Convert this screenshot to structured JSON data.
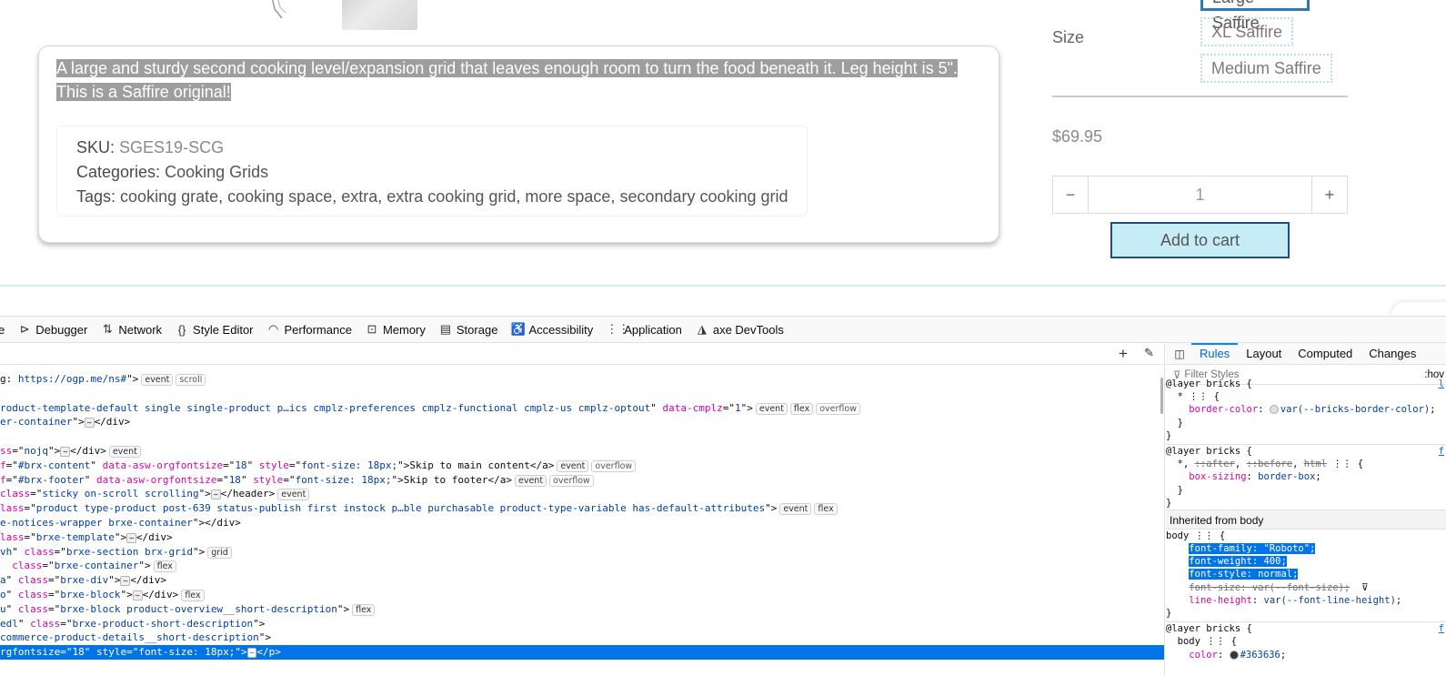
{
  "product": {
    "description": "A large and sturdy second cooking level/expansion grid that leaves enough room to turn the food beneath it. Leg height is 5\". This is a Saffire original!",
    "sku_label": "SKU:",
    "sku_value": "SGES19-SCG",
    "categories_label": "Categories:",
    "categories_value": "Cooking Grids",
    "tags_label": "Tags:",
    "tags": [
      "cooking grate",
      "cooking space",
      "extra",
      "extra cooking grid",
      "more space",
      "secondary cooking grid"
    ],
    "size_label": "Size",
    "size_options": [
      "Large Saffire",
      "XL Saffire",
      "Medium Saffire"
    ],
    "price": "$69.95",
    "quantity": "1",
    "minus_label": "−",
    "plus_label": "+",
    "add_to_cart": "Add to cart",
    "colors": {
      "cart_bg": "#c6ecf6",
      "cart_border": "#1c4f7a",
      "chip_selected": "#2b7bb9"
    }
  },
  "devtools": {
    "tools": [
      {
        "icon": "console-icon",
        "glyph": "",
        "label": "e"
      },
      {
        "icon": "debugger-icon",
        "glyph": "⊳",
        "label": "Debugger"
      },
      {
        "icon": "network-icon",
        "glyph": "⇅",
        "label": "Network"
      },
      {
        "icon": "style-editor-icon",
        "glyph": "{}",
        "label": "Style Editor"
      },
      {
        "icon": "performance-icon",
        "glyph": "◠",
        "label": "Performance"
      },
      {
        "icon": "memory-icon",
        "glyph": "⊡",
        "label": "Memory"
      },
      {
        "icon": "storage-icon",
        "glyph": "▤",
        "label": "Storage"
      },
      {
        "icon": "accessibility-icon",
        "glyph": "♿",
        "label": "Accessibility"
      },
      {
        "icon": "application-icon",
        "glyph": "⋮⋮",
        "label": "Application"
      },
      {
        "icon": "axe-icon",
        "glyph": "◮",
        "label": "axe DevTools"
      }
    ],
    "markup_lines": [
      {
        "parts": [
          [
            "t",
            "g: "
          ],
          [
            "v",
            "https://ogp.me/ns#"
          ],
          [
            "t",
            "\">"
          ]
        ],
        "badges": [
          "event",
          "scroll"
        ]
      },
      {
        "parts": [],
        "badges": []
      },
      {
        "parts": [
          [
            "v",
            "roduct-template-default single single-product p…ics cmplz-preferences cmplz-functional cmplz-us cmplz-optout"
          ],
          [
            "t",
            "\" "
          ],
          [
            "a",
            "data-cmplz"
          ],
          [
            "t",
            "=\""
          ],
          [
            "v",
            "1"
          ],
          [
            "t",
            "\">"
          ]
        ],
        "badges": [
          "event",
          "flex",
          "overflow"
        ]
      },
      {
        "parts": [
          [
            "v",
            "er-container"
          ],
          [
            "t",
            "\">"
          ],
          [
            "d",
            "⋯"
          ],
          [
            "t",
            "</div>"
          ]
        ],
        "badges": []
      },
      {
        "parts": [],
        "badges": []
      },
      {
        "parts": [
          [
            "a",
            "ss"
          ],
          [
            "t",
            "=\""
          ],
          [
            "v",
            "nojq"
          ],
          [
            "t",
            "\">"
          ],
          [
            "d",
            "⋯"
          ],
          [
            "t",
            "</div>"
          ]
        ],
        "badges": [
          "event"
        ]
      },
      {
        "parts": [
          [
            "a",
            "f"
          ],
          [
            "t",
            "=\""
          ],
          [
            "v",
            "#brx-content"
          ],
          [
            "t",
            "\" "
          ],
          [
            "a",
            "data-asw-orgfontsize"
          ],
          [
            "t",
            "=\""
          ],
          [
            "v",
            "18"
          ],
          [
            "t",
            "\" "
          ],
          [
            "a",
            "style"
          ],
          [
            "t",
            "=\""
          ],
          [
            "v",
            "font-size: 18px;"
          ],
          [
            "t",
            "\">Skip to main content</a>"
          ]
        ],
        "badges": [
          "event",
          "overflow"
        ]
      },
      {
        "parts": [
          [
            "a",
            "f"
          ],
          [
            "t",
            "=\""
          ],
          [
            "v",
            "#brx-footer"
          ],
          [
            "t",
            "\" "
          ],
          [
            "a",
            "data-asw-orgfontsize"
          ],
          [
            "t",
            "=\""
          ],
          [
            "v",
            "18"
          ],
          [
            "t",
            "\" "
          ],
          [
            "a",
            "style"
          ],
          [
            "t",
            "=\""
          ],
          [
            "v",
            "font-size: 18px;"
          ],
          [
            "t",
            "\">Skip to footer</a>"
          ]
        ],
        "badges": [
          "event",
          "overflow"
        ]
      },
      {
        "parts": [
          [
            "a",
            "class"
          ],
          [
            "t",
            "=\""
          ],
          [
            "v",
            "sticky on-scroll scrolling"
          ],
          [
            "t",
            "\">"
          ],
          [
            "d",
            "⋯"
          ],
          [
            "t",
            "</header>"
          ]
        ],
        "badges": [
          "event"
        ]
      },
      {
        "parts": [
          [
            "a",
            "lass"
          ],
          [
            "t",
            "=\""
          ],
          [
            "v",
            "product type-product post-639 status-publish first instock p…ble purchasable product-type-variable has-default-attributes"
          ],
          [
            "t",
            "\">"
          ]
        ],
        "badges": [
          "event",
          "flex"
        ]
      },
      {
        "parts": [
          [
            "v",
            "e-notices-wrapper brxe-container"
          ],
          [
            "t",
            "\"></div>"
          ]
        ],
        "badges": []
      },
      {
        "parts": [
          [
            "a",
            "lass"
          ],
          [
            "t",
            "=\""
          ],
          [
            "v",
            "brxe-template"
          ],
          [
            "t",
            "\">"
          ],
          [
            "d",
            "⋯"
          ],
          [
            "t",
            "</div>"
          ]
        ],
        "badges": []
      },
      {
        "parts": [
          [
            "v",
            "vh"
          ],
          [
            "t",
            "\" "
          ],
          [
            "a",
            "class"
          ],
          [
            "t",
            "=\""
          ],
          [
            "v",
            "brxe-section brx-grid"
          ],
          [
            "t",
            "\">"
          ]
        ],
        "badges": [
          "grid"
        ]
      },
      {
        "parts": [
          [
            "t",
            "  "
          ],
          [
            "a",
            "class"
          ],
          [
            "t",
            "=\""
          ],
          [
            "v",
            "brxe-container"
          ],
          [
            "t",
            "\">"
          ]
        ],
        "badges": [
          "flex"
        ]
      },
      {
        "parts": [
          [
            "v",
            "a"
          ],
          [
            "t",
            "\" "
          ],
          [
            "a",
            "class"
          ],
          [
            "t",
            "=\""
          ],
          [
            "v",
            "brxe-div"
          ],
          [
            "t",
            "\">"
          ],
          [
            "d",
            "⋯"
          ],
          [
            "t",
            "</div>"
          ]
        ],
        "badges": []
      },
      {
        "parts": [
          [
            "v",
            "o"
          ],
          [
            "t",
            "\" "
          ],
          [
            "a",
            "class"
          ],
          [
            "t",
            "=\""
          ],
          [
            "v",
            "brxe-block"
          ],
          [
            "t",
            "\">"
          ],
          [
            "d",
            "⋯"
          ],
          [
            "t",
            "</div>"
          ]
        ],
        "badges": [
          "flex"
        ]
      },
      {
        "parts": [
          [
            "v",
            "u"
          ],
          [
            "t",
            "\" "
          ],
          [
            "a",
            "class"
          ],
          [
            "t",
            "=\""
          ],
          [
            "v",
            "brxe-block product-overview__short-description"
          ],
          [
            "t",
            "\">"
          ]
        ],
        "badges": [
          "flex"
        ]
      },
      {
        "parts": [
          [
            "v",
            "edl"
          ],
          [
            "t",
            "\" "
          ],
          [
            "a",
            "class"
          ],
          [
            "t",
            "=\""
          ],
          [
            "v",
            "brxe-product-short-description"
          ],
          [
            "t",
            "\">"
          ]
        ],
        "badges": []
      },
      {
        "parts": [
          [
            "v",
            "commerce-product-details__short-description"
          ],
          [
            "t",
            "\">"
          ]
        ],
        "badges": []
      },
      {
        "parts": [
          [
            "v",
            "rgfontsize"
          ],
          [
            "t",
            "=\""
          ],
          [
            "v",
            "18"
          ],
          [
            "t",
            "\" "
          ],
          [
            "a",
            "style"
          ],
          [
            "t",
            "=\""
          ],
          [
            "v",
            "font-size: 18px;"
          ],
          [
            "t",
            "\">"
          ],
          [
            "d",
            "⋯"
          ],
          [
            "t",
            "</p>"
          ]
        ],
        "badges": [],
        "selected": true
      }
    ],
    "right_tabs": [
      "Rules",
      "Layout",
      "Computed",
      "Changes"
    ],
    "active_tab": "Rules",
    "filter_placeholder": "Filter Styles",
    "hov_label": ":hov",
    "inherited_label": "Inherited from body",
    "rules": [
      {
        "kind": "line",
        "html": [
          [
            "t",
            "@layer bricks {"
          ]
        ],
        "src": "l"
      },
      {
        "kind": "line",
        "html": [
          [
            "t",
            "  * "
          ],
          [
            "t",
            "⋮⋮ {"
          ]
        ]
      },
      {
        "kind": "line",
        "html": [
          [
            "t",
            "    "
          ],
          [
            "p",
            "border-color"
          ],
          [
            "t",
            ": "
          ],
          [
            "sw",
            "#e0e0e0"
          ],
          [
            "pv",
            "var(--bricks-border-color)"
          ],
          [
            "t",
            ";"
          ]
        ]
      },
      {
        "kind": "line",
        "html": [
          [
            "t",
            "  }"
          ]
        ]
      },
      {
        "kind": "line",
        "html": [
          [
            "t",
            "}"
          ]
        ]
      },
      {
        "kind": "sep"
      },
      {
        "kind": "line",
        "html": [
          [
            "t",
            "@layer bricks {"
          ]
        ],
        "src": "f"
      },
      {
        "kind": "line",
        "html": [
          [
            "t",
            "  *, "
          ],
          [
            "s",
            "::after"
          ],
          [
            "t",
            ", "
          ],
          [
            "s",
            "::before"
          ],
          [
            "t",
            ", "
          ],
          [
            "s",
            "html"
          ],
          [
            "t",
            " ⋮⋮ {"
          ]
        ]
      },
      {
        "kind": "line",
        "html": [
          [
            "t",
            "    "
          ],
          [
            "p",
            "box-sizing"
          ],
          [
            "t",
            ": "
          ],
          [
            "pv",
            "border-box"
          ],
          [
            "t",
            ";"
          ]
        ]
      },
      {
        "kind": "line",
        "html": [
          [
            "t",
            "  }"
          ]
        ]
      },
      {
        "kind": "line",
        "html": [
          [
            "t",
            "}"
          ]
        ]
      },
      {
        "kind": "inherit"
      },
      {
        "kind": "line",
        "html": [
          [
            "t",
            "body ⋮⋮ {"
          ]
        ]
      },
      {
        "kind": "line",
        "html": [
          [
            "t",
            "    "
          ],
          [
            "h",
            "font-family: \"Roboto\";"
          ]
        ]
      },
      {
        "kind": "line",
        "html": [
          [
            "t",
            "    "
          ],
          [
            "h",
            "font-weight: 400;"
          ]
        ]
      },
      {
        "kind": "line",
        "html": [
          [
            "t",
            "    "
          ],
          [
            "h",
            "font-style: normal;"
          ]
        ]
      },
      {
        "kind": "line",
        "html": [
          [
            "t",
            "    "
          ],
          [
            "s",
            "font-size: var(--font-size);"
          ],
          [
            "t",
            "  ⊽"
          ]
        ]
      },
      {
        "kind": "line",
        "html": [
          [
            "t",
            "    "
          ],
          [
            "p",
            "line-height"
          ],
          [
            "t",
            ": "
          ],
          [
            "pv",
            "var(--font-line-height)"
          ],
          [
            "t",
            ";"
          ]
        ]
      },
      {
        "kind": "line",
        "html": [
          [
            "t",
            "}"
          ]
        ]
      },
      {
        "kind": "sep"
      },
      {
        "kind": "line",
        "html": [
          [
            "t",
            "@layer bricks {"
          ]
        ],
        "src": "f"
      },
      {
        "kind": "line",
        "html": [
          [
            "t",
            "  body ⋮⋮ {"
          ]
        ]
      },
      {
        "kind": "line",
        "html": [
          [
            "t",
            "    "
          ],
          [
            "p",
            "color"
          ],
          [
            "t",
            ": "
          ],
          [
            "sw",
            "#363636"
          ],
          [
            "pv",
            "#363636"
          ],
          [
            "t",
            ";"
          ]
        ]
      }
    ]
  }
}
